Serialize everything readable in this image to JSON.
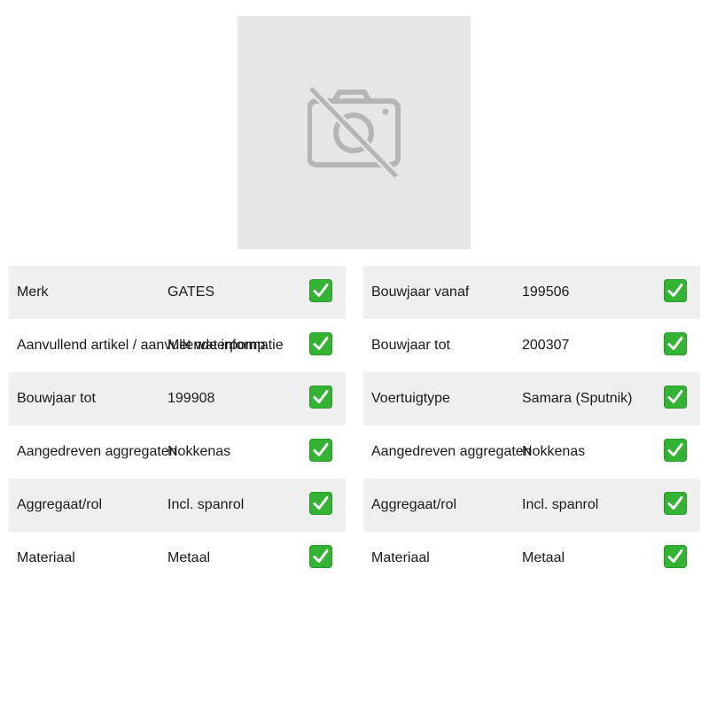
{
  "product_image": {
    "icon": "no-photo-icon"
  },
  "specs_left": [
    {
      "label": "Merk",
      "value": "GATES",
      "status_icon": "check-icon"
    },
    {
      "label": "Aanvullend artikel / aanvullende informatie",
      "value": "Met waterpomp",
      "status_icon": "check-icon"
    },
    {
      "label": "Bouwjaar tot",
      "value": "199908",
      "status_icon": "check-icon"
    },
    {
      "label": "Aangedreven aggregaten",
      "value": "Nokkenas",
      "status_icon": "check-icon"
    },
    {
      "label": "Aggregaat/rol",
      "value": "Incl. spanrol",
      "status_icon": "check-icon"
    },
    {
      "label": "Materiaal",
      "value": "Metaal",
      "status_icon": "check-icon"
    }
  ],
  "specs_right": [
    {
      "label": "Bouwjaar vanaf",
      "value": "199506",
      "status_icon": "check-icon"
    },
    {
      "label": "Bouwjaar tot",
      "value": "200307",
      "status_icon": "check-icon"
    },
    {
      "label": "Voertuigtype",
      "value": "Samara (Sputnik)",
      "status_icon": "check-icon"
    },
    {
      "label": "Aangedreven aggregaten",
      "value": "Nokkenas",
      "status_icon": "check-icon"
    },
    {
      "label": "Aggregaat/rol",
      "value": "Incl. spanrol",
      "status_icon": "check-icon"
    },
    {
      "label": "Materiaal",
      "value": "Metaal",
      "status_icon": "check-icon"
    }
  ],
  "colors": {
    "row_shaded": "#efefef",
    "placeholder_bg": "#e6e6e6",
    "check_green": "#34b233"
  }
}
